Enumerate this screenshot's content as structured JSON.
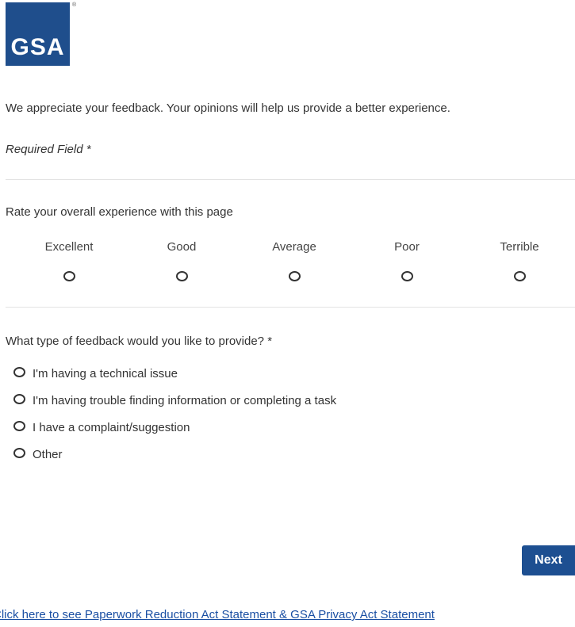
{
  "logo": {
    "text": "GSA",
    "registered": "®",
    "color": "#1f4e8c"
  },
  "intro_text": "We appreciate your feedback. Your opinions will help us provide a better experience.",
  "required_note": "Required Field *",
  "rating_question": {
    "label": "Rate your overall experience with this page",
    "options": [
      "Excellent",
      "Good",
      "Average",
      "Poor",
      "Terrible"
    ],
    "selected": null
  },
  "feedback_type_question": {
    "label": "What type of feedback would you like to provide? *",
    "options": [
      "I'm having a technical issue",
      "I'm having trouble finding information or completing a task",
      "I have a complaint/suggestion",
      "Other"
    ],
    "selected": null
  },
  "next_button": {
    "label": "Next",
    "color": "#1d4f91"
  },
  "footer_link": {
    "text": "Click here to see Paperwork Reduction Act Statement & GSA Privacy Act Statement",
    "color": "#1a4fa3"
  }
}
